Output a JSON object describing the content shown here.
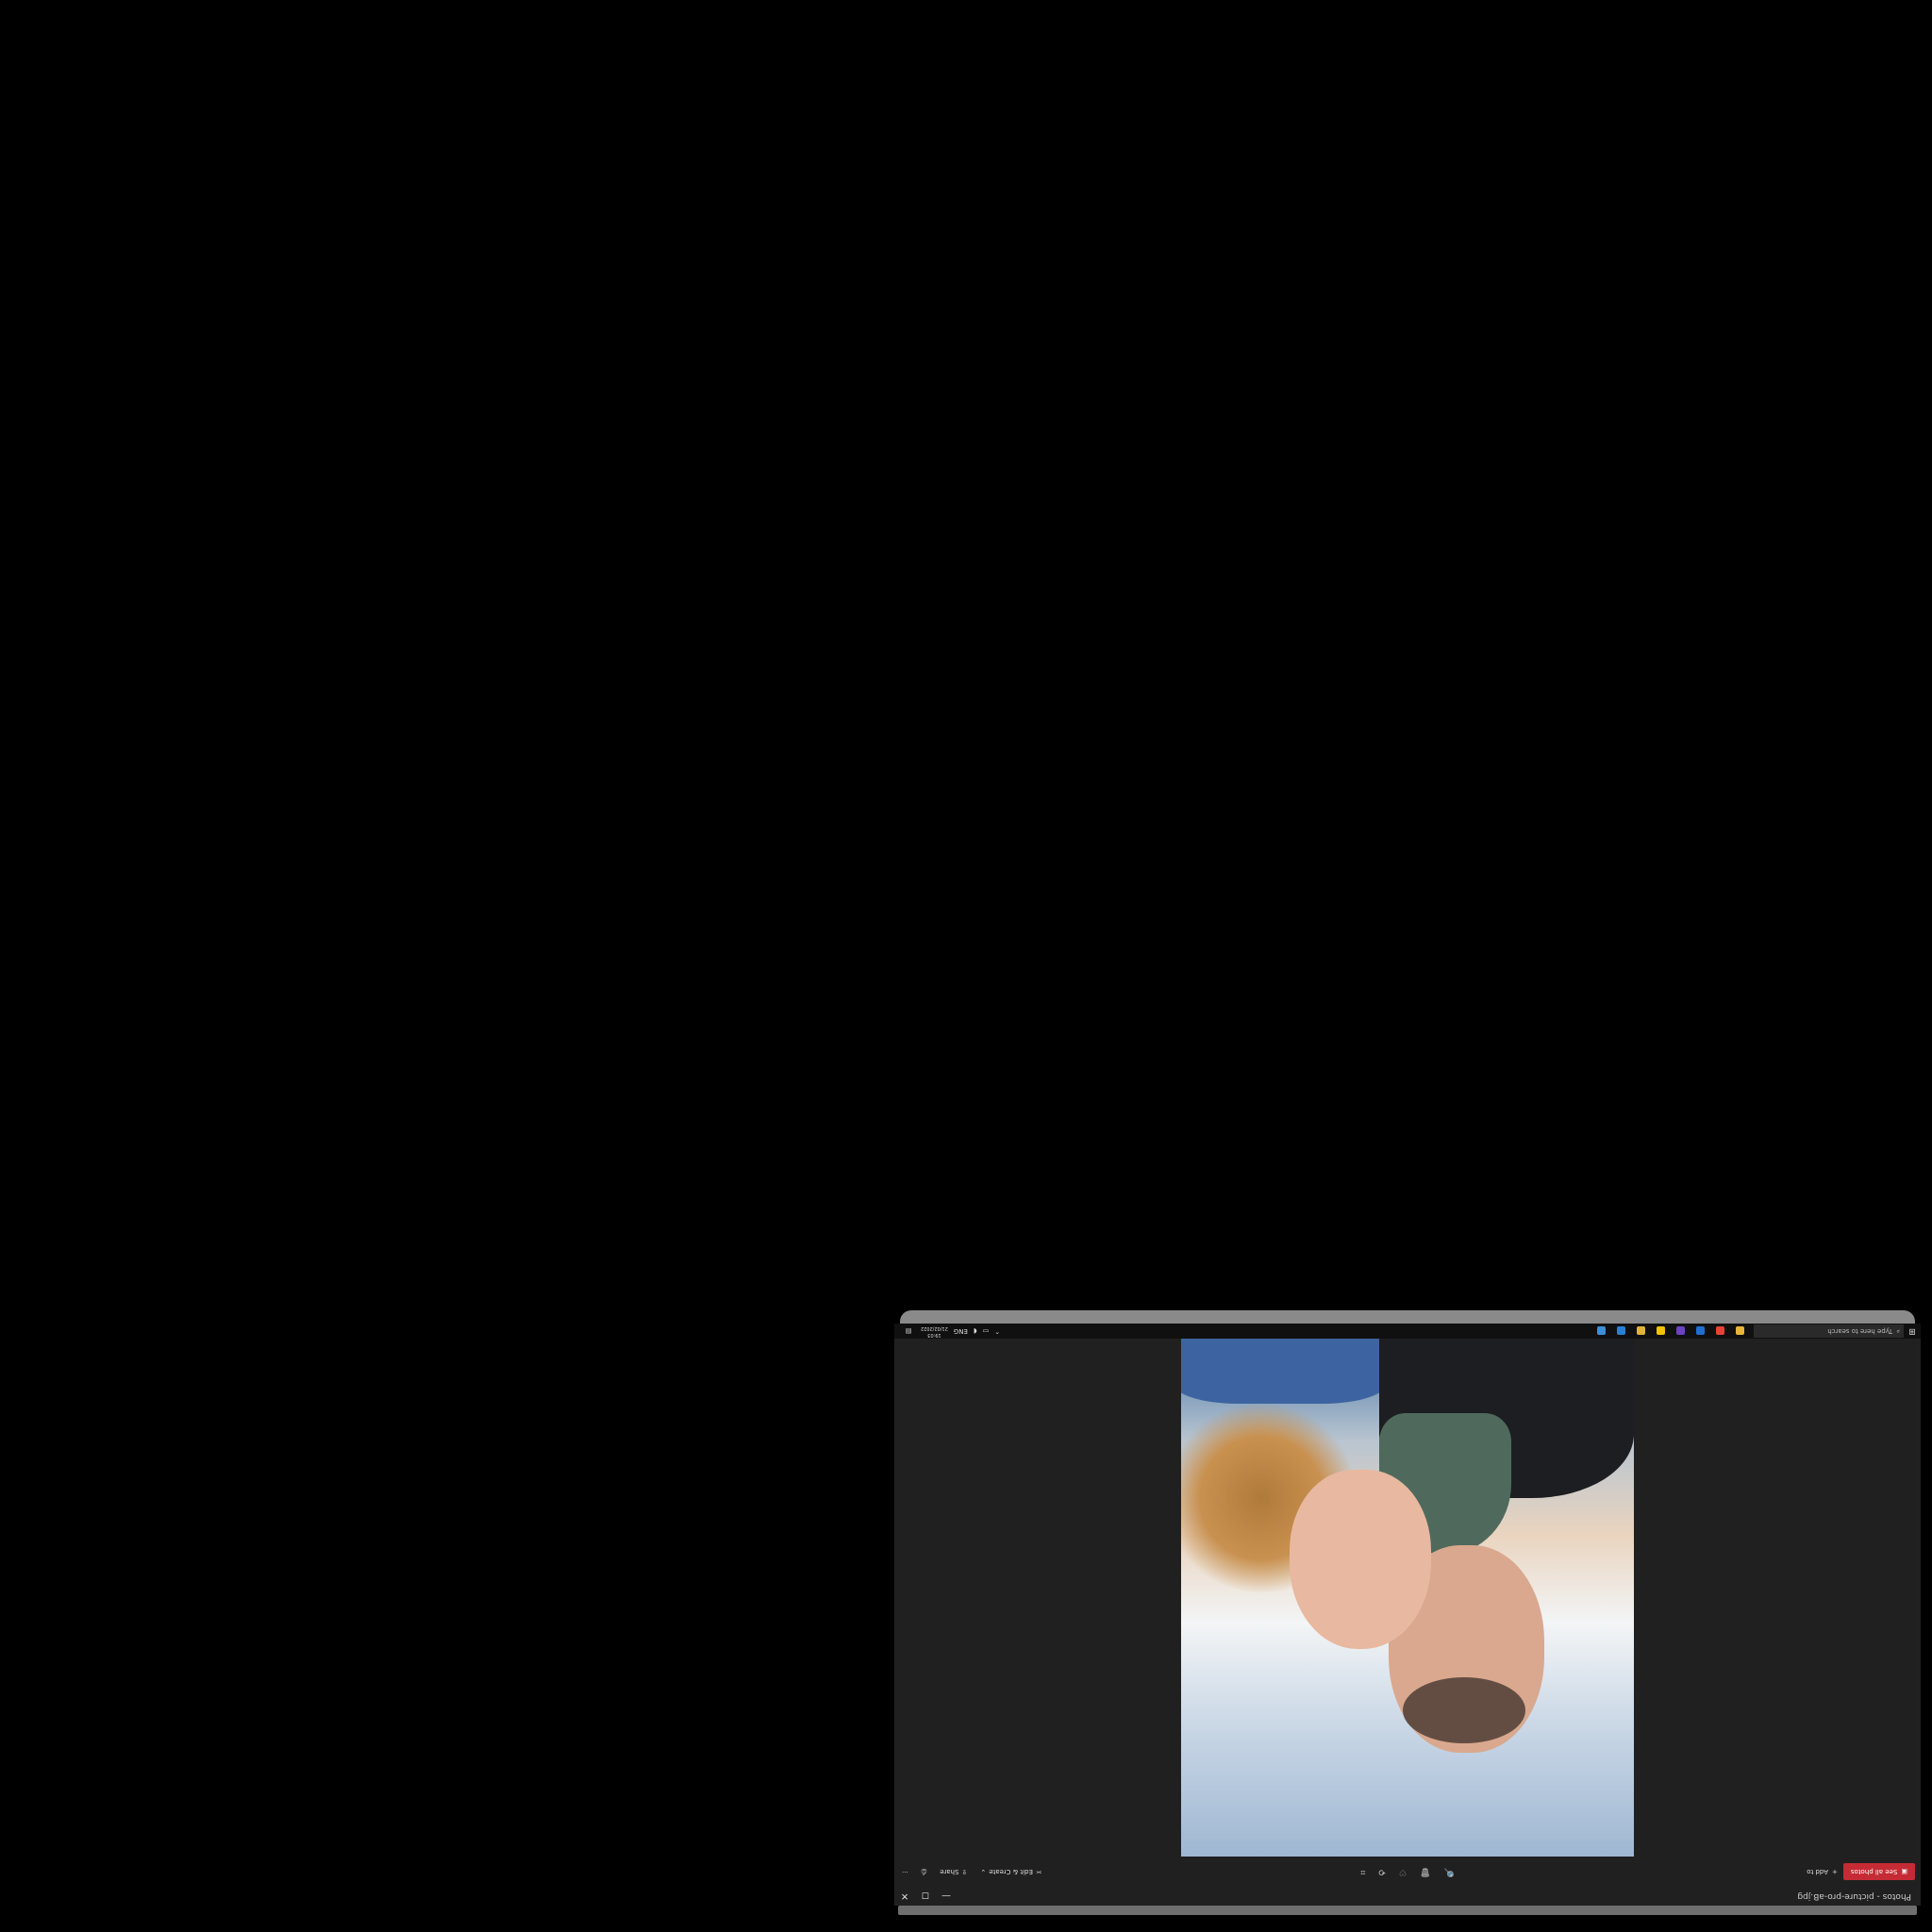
{
  "window": {
    "title": "Photos - picture-pro-aB.jpg",
    "minimize": "—",
    "maximize": "◻",
    "close": "✕"
  },
  "commandbar": {
    "see_all_photos": "See all photos",
    "add_to": "Add to",
    "zoom": "🔍",
    "delete": "🗑",
    "favorite": "♡",
    "rotate": "⟲",
    "crop": "⌗",
    "edit_create": "Edit & Create",
    "share": "Share",
    "print": "⎙",
    "more": "···"
  },
  "photo": {
    "description_icon": "couple-selfie-photo"
  },
  "taskbar": {
    "search_placeholder": "Type here to search",
    "language": "ENG",
    "time": "19:03",
    "date": "21/02/2022",
    "apps": [
      {
        "name": "explorer-icon",
        "color": "#e8b43a"
      },
      {
        "name": "chrome-icon",
        "color": "#e94235"
      },
      {
        "name": "store-icon",
        "color": "#1f6fd1"
      },
      {
        "name": "mail-icon",
        "color": "#6a42c2"
      },
      {
        "name": "norton-icon",
        "color": "#f2c200"
      },
      {
        "name": "files-icon",
        "color": "#e0b33a"
      },
      {
        "name": "photoshop-icon",
        "color": "#2a7fd4"
      },
      {
        "name": "photos-icon",
        "color": "#3c8ed8"
      }
    ]
  }
}
